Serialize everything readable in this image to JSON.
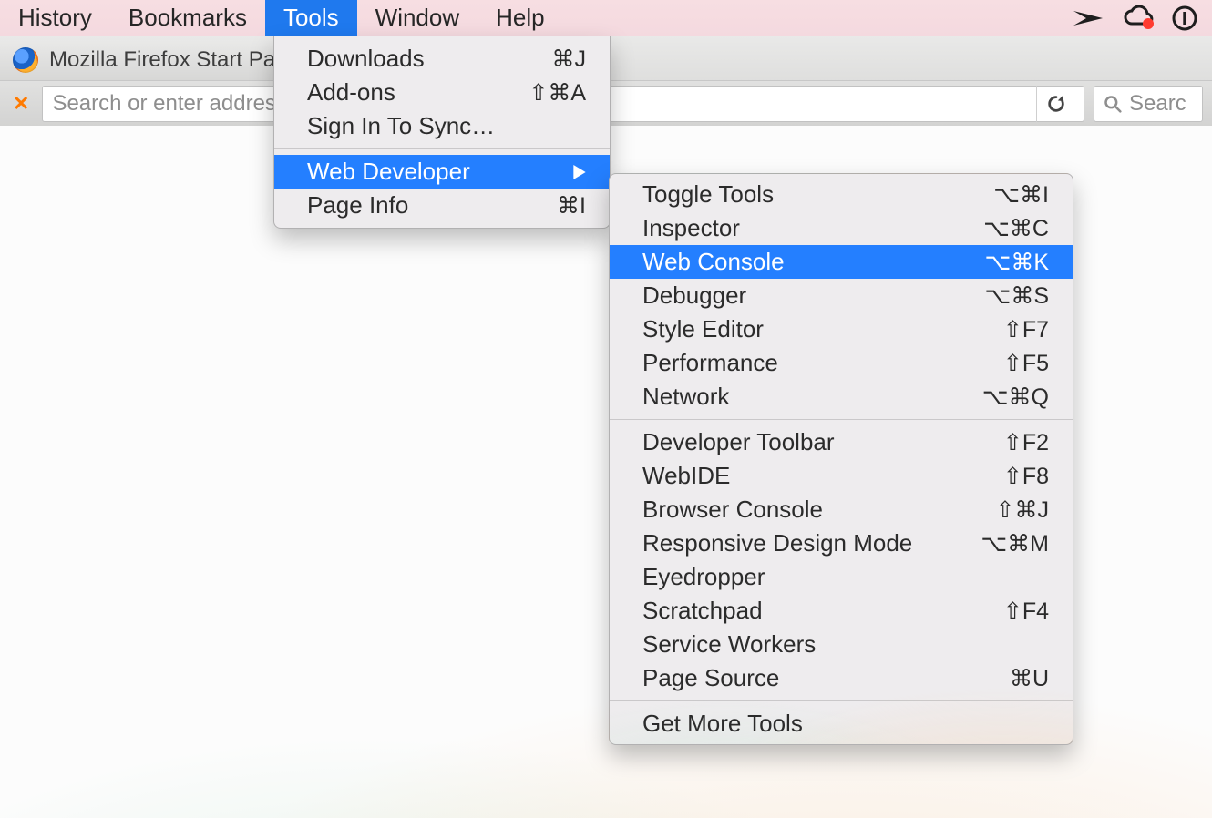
{
  "menubar": {
    "history": "History",
    "bookmarks": "Bookmarks",
    "tools": "Tools",
    "window": "Window",
    "help": "Help"
  },
  "browser": {
    "tab_title": "Mozilla Firefox Start Pa",
    "url_placeholder": "Search or enter address",
    "search_placeholder": "Searc"
  },
  "tools_menu": {
    "downloads": {
      "label": "Downloads",
      "shortcut": "⌘J"
    },
    "addons": {
      "label": "Add-ons",
      "shortcut": "⇧⌘A"
    },
    "signin": {
      "label": "Sign In To Sync…",
      "shortcut": ""
    },
    "webdev": {
      "label": "Web Developer"
    },
    "pageinfo": {
      "label": "Page Info",
      "shortcut": "⌘I"
    }
  },
  "webdev_menu": [
    {
      "label": "Toggle Tools",
      "shortcut": "⌥⌘I"
    },
    {
      "label": "Inspector",
      "shortcut": "⌥⌘C"
    },
    {
      "label": "Web Console",
      "shortcut": "⌥⌘K",
      "active": true
    },
    {
      "label": "Debugger",
      "shortcut": "⌥⌘S"
    },
    {
      "label": "Style Editor",
      "shortcut": "⇧F7"
    },
    {
      "label": "Performance",
      "shortcut": "⇧F5"
    },
    {
      "label": "Network",
      "shortcut": "⌥⌘Q"
    },
    {
      "sep": true
    },
    {
      "label": "Developer Toolbar",
      "shortcut": "⇧F2"
    },
    {
      "label": "WebIDE",
      "shortcut": "⇧F8"
    },
    {
      "label": "Browser Console",
      "shortcut": "⇧⌘J"
    },
    {
      "label": "Responsive Design Mode",
      "shortcut": "⌥⌘M"
    },
    {
      "label": "Eyedropper",
      "shortcut": ""
    },
    {
      "label": "Scratchpad",
      "shortcut": "⇧F4"
    },
    {
      "label": "Service Workers",
      "shortcut": ""
    },
    {
      "label": "Page Source",
      "shortcut": "⌘U"
    },
    {
      "sep": true
    },
    {
      "label": "Get More Tools",
      "shortcut": ""
    }
  ]
}
